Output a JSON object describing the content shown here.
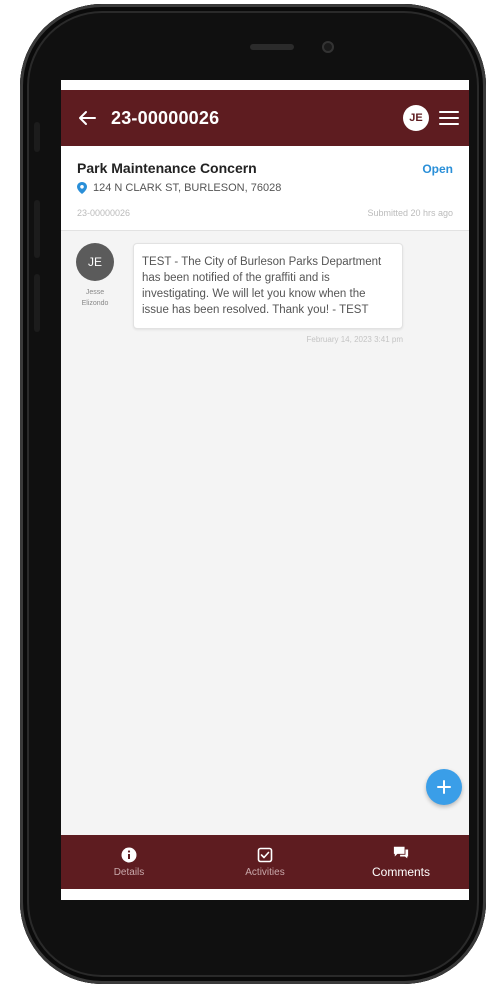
{
  "header": {
    "title": "23-00000026",
    "avatar_initials": "JE",
    "back_icon": "arrow-left-icon",
    "menu_icon": "hamburger-menu-icon",
    "bar_color": "#5e1c20"
  },
  "request": {
    "title": "Park Maintenance Concern",
    "status": "Open",
    "address": "124 N CLARK ST, BURLESON, 76028",
    "id": "23-00000026",
    "submitted": "Submitted 20 hrs ago",
    "status_color": "#2a8fd8"
  },
  "comments": [
    {
      "author_initials": "JE",
      "author_name": "Jesse Elizondo",
      "text": "TEST - The City of Burleson Parks Department has been notified of the graffiti and is investigating. We will let you know when the issue has been resolved. Thank you! - TEST",
      "timestamp": "February 14, 2023 3:41 pm"
    }
  ],
  "fab": {
    "icon": "plus-icon",
    "color": "#3a9ee8"
  },
  "nav": {
    "items": [
      {
        "label": "Details",
        "icon": "info-icon"
      },
      {
        "label": "Activities",
        "icon": "checkbox-icon"
      },
      {
        "label": "Comments",
        "icon": "chat-icon",
        "active": true
      }
    ]
  }
}
